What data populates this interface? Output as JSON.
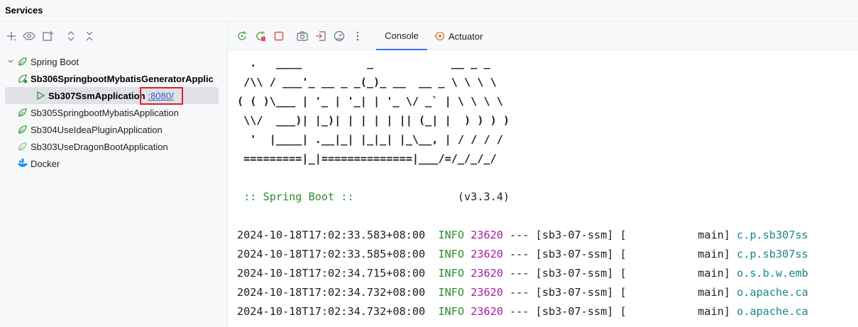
{
  "window": {
    "title": "Services"
  },
  "left_toolbar": {
    "icons": [
      "add-icon",
      "eye-icon",
      "new-tab-icon",
      "expand-all-icon",
      "collapse-all-icon"
    ]
  },
  "tree": {
    "spring_boot": {
      "label": "Spring Boot"
    },
    "apps": [
      {
        "label": "Sb306SpringbootMybatisGeneratorApplic",
        "bold": true
      },
      {
        "label": "Sb307SsmApplication",
        "port": ":8080/",
        "bold": true,
        "running": true
      },
      {
        "label": "Sb305SpringbootMybatisApplication",
        "bold": false
      },
      {
        "label": "Sb304UseIdeaPluginApplication",
        "bold": false
      },
      {
        "label": "Sb303UseDragonBootApplication",
        "bold": false
      }
    ],
    "docker": {
      "label": "Docker"
    }
  },
  "right_toolbar": {
    "icons": [
      "rerun-icon",
      "restart-icon",
      "stop-icon",
      "camera-icon",
      "sign-in-icon",
      "dashboard-icon",
      "more-icon"
    ],
    "tabs": {
      "console": "Console",
      "actuator": "Actuator"
    }
  },
  "console": {
    "banner": [
      "  .   ____          _            __ _ _",
      " /\\\\ / ___'_ __ _ _(_)_ __  __ _ \\ \\ \\ \\",
      "( ( )\\___ | '_ | '_| | '_ \\/ _` | \\ \\ \\ \\",
      " \\\\/  ___)| |_)| | | | | || (_| |  ) ) ) )",
      "  '  |____| .__|_| |_|_| |_\\__, | / / / /",
      " =========|_|==============|___/=/_/_/_/"
    ],
    "spring_boot_label": " :: Spring Boot :: ",
    "version": "(v3.3.4)",
    "logs": [
      {
        "time": "2024-10-18T17:02:33.583+08:00",
        "level": "INFO",
        "pid": "23620",
        "sep": "---",
        "app": "[sb3-07-ssm]",
        "thread": "[           main]",
        "logger": "c.p.sb307ss"
      },
      {
        "time": "2024-10-18T17:02:33.585+08:00",
        "level": "INFO",
        "pid": "23620",
        "sep": "---",
        "app": "[sb3-07-ssm]",
        "thread": "[           main]",
        "logger": "c.p.sb307ss"
      },
      {
        "time": "2024-10-18T17:02:34.715+08:00",
        "level": "INFO",
        "pid": "23620",
        "sep": "---",
        "app": "[sb3-07-ssm]",
        "thread": "[           main]",
        "logger": "o.s.b.w.emb"
      },
      {
        "time": "2024-10-18T17:02:34.732+08:00",
        "level": "INFO",
        "pid": "23620",
        "sep": "---",
        "app": "[sb3-07-ssm]",
        "thread": "[           main]",
        "logger": "o.apache.ca"
      },
      {
        "time": "2024-10-18T17:02:34.732+08:00",
        "level": "INFO",
        "pid": "23620",
        "sep": "---",
        "app": "[sb3-07-ssm]",
        "thread": "[           main]",
        "logger": "o.apache.ca"
      }
    ]
  },
  "colors": {
    "accent": "#3574f0",
    "info": "#2e8b2e",
    "pid": "#a020a0",
    "logger": "#17878a",
    "highlight_box": "#e02020",
    "link": "#2a62c9"
  }
}
